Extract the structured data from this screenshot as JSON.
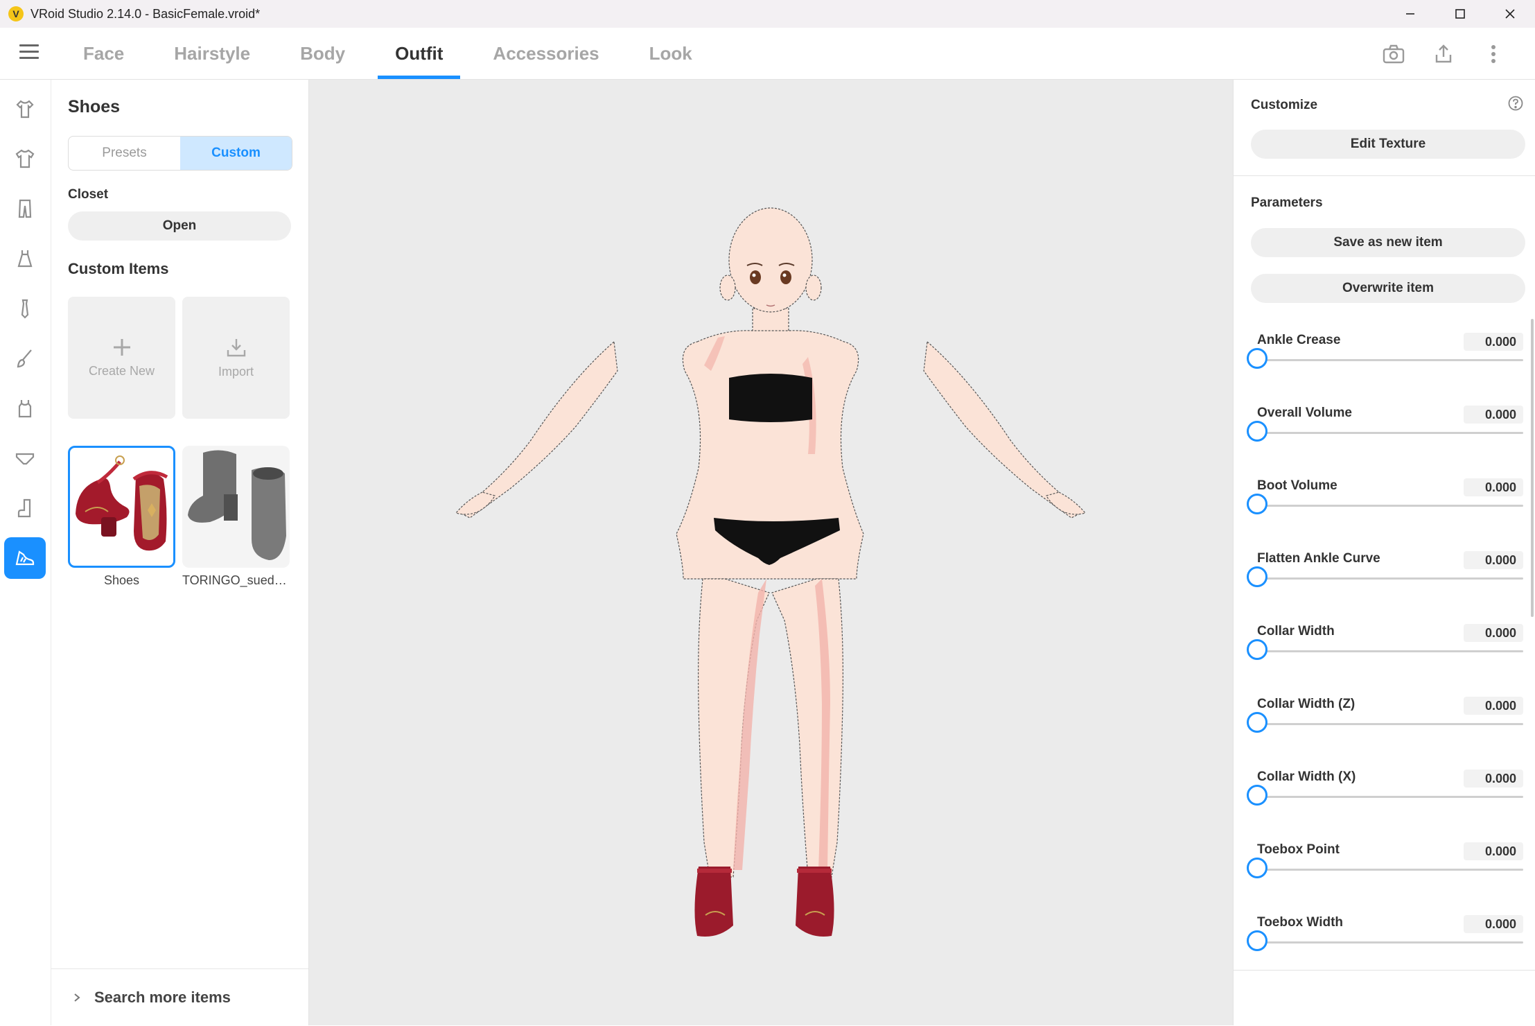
{
  "window": {
    "title": "VRoid Studio 2.14.0 - BasicFemale.vroid*",
    "logo_letter": "V"
  },
  "nav": {
    "tabs": [
      {
        "label": "Face",
        "active": false
      },
      {
        "label": "Hairstyle",
        "active": false
      },
      {
        "label": "Body",
        "active": false
      },
      {
        "label": "Outfit",
        "active": true
      },
      {
        "label": "Accessories",
        "active": false
      },
      {
        "label": "Look",
        "active": false
      }
    ],
    "icons": [
      "camera-icon",
      "export-icon",
      "more-vert-icon"
    ]
  },
  "rail": {
    "items": [
      "tops-icon",
      "shirt-icon",
      "pants-icon",
      "dress-icon",
      "tie-icon",
      "brush-icon",
      "vest-icon",
      "underwear-icon",
      "socks-icon",
      "shoes-icon"
    ],
    "active": "shoes-icon"
  },
  "left": {
    "title": "Shoes",
    "segment": {
      "presets": "Presets",
      "custom": "Custom"
    },
    "closet_title": "Closet",
    "closet_button": "Open",
    "custom_items_title": "Custom Items",
    "create_new": "Create New",
    "import": "Import",
    "items": [
      {
        "label": "Shoes",
        "selected": true
      },
      {
        "label": "TORINGO_suede_boots",
        "selected": false
      }
    ],
    "search_more": "Search more items"
  },
  "right": {
    "customize_title": "Customize",
    "edit_texture": "Edit Texture",
    "parameters_title": "Parameters",
    "save_new": "Save as new item",
    "overwrite": "Overwrite item",
    "params": [
      {
        "label": "Ankle Crease",
        "value": "0.000",
        "level": 0
      },
      {
        "label": "Overall Volume",
        "value": "0.000",
        "level": 0
      },
      {
        "label": "Boot Volume",
        "value": "0.000",
        "level": 0
      },
      {
        "label": "Flatten Ankle Curve",
        "value": "0.000",
        "level": 0
      },
      {
        "label": "Collar Width",
        "value": "0.000",
        "level": 0
      },
      {
        "label": "Collar Width (Z)",
        "value": "0.000",
        "level": 0
      },
      {
        "label": "Collar Width (X)",
        "value": "0.000",
        "level": 0
      },
      {
        "label": "Toebox Point",
        "value": "0.000",
        "level": 0
      },
      {
        "label": "Toebox Width",
        "value": "0.000",
        "level": 0
      }
    ]
  },
  "colors": {
    "accent": "#1a90ff",
    "skin": "#fbe3d7",
    "skin_shadow": "#f2b3ab",
    "clothing": "#111111",
    "shoe": "#9b1b2c"
  }
}
